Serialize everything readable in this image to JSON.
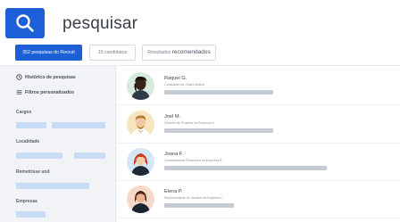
{
  "search": {
    "query": "pesquisar",
    "button_icon": "search-icon"
  },
  "tabs": [
    {
      "label": "352 pesquisas do Recruit",
      "active": true
    },
    {
      "label": "15 candidatos",
      "active": false
    },
    {
      "prefix": "Resultados",
      "highlight": "recomendados",
      "active": false
    }
  ],
  "sidebar": {
    "history_label": "Histórico de pesquisas",
    "history_icon": "clock-icon",
    "filters_label": "Filtros personalizados",
    "filters_icon": "menu-lines-icon",
    "sections": [
      {
        "title": "Cargos"
      },
      {
        "title": "Localidade"
      },
      {
        "title": "Remetrisse und"
      },
      {
        "title": "Empresas"
      }
    ]
  },
  "results": [
    {
      "name": "Raquel G.",
      "role": "Consultant em Sales Market"
    },
    {
      "name": "Joel M.",
      "role": "Gerente de Projetos na Empresa A"
    },
    {
      "name": "Joana F.",
      "role": "Coordenadora Financeira na Empresa B"
    },
    {
      "name": "Elena P.",
      "role": "Representante de Vendas na Empresa C"
    }
  ],
  "colors": {
    "accent": "#1d5fd6",
    "chip": "#c9dcf5",
    "placeholder_bar": "#c4cbd4"
  }
}
